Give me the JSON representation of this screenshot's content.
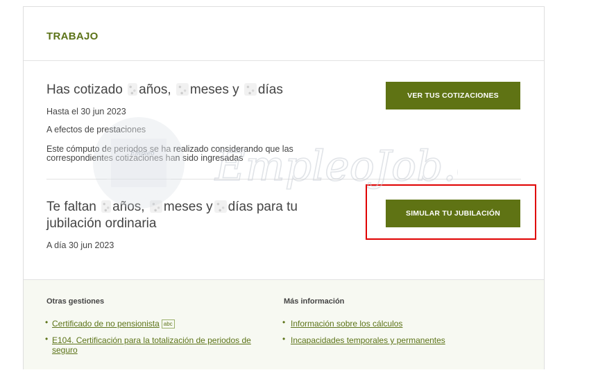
{
  "section": {
    "title": "TRABAJO"
  },
  "cotizado": {
    "heading_prefix": "Has cotizado",
    "heading_years": "años,",
    "heading_months": "meses y",
    "heading_days": "días",
    "date": "Hasta el 30 jun 2023",
    "purpose": "A efectos de prestaciones",
    "note_line1": "Este cómputo de periodos se ha realizado considerando que las",
    "note_line2": "correspondientes cotizaciones han sido ingresadas",
    "button": "VER TUS COTIZACIONES"
  },
  "faltan": {
    "heading_prefix": "Te faltan",
    "heading_years": "años,",
    "heading_months": "meses y",
    "heading_days": "días para tu",
    "heading_line2": "jubilación ordinaria",
    "date": "A día 30 jun 2023",
    "button": "SIMULAR TU JUBILACIÓN"
  },
  "footer": {
    "col1": {
      "title": "Otras gestiones",
      "links": [
        "Certificado de no pensionista",
        "E104. Certificación para la totalización de periodos de",
        "seguro"
      ],
      "badge": "abc"
    },
    "col2": {
      "title": "Más información",
      "links": [
        "Información sobre los cálculos",
        "Incapacidades temporales y permanentes"
      ]
    }
  },
  "watermark": {
    "text": "EmpleoJob.es",
    "logo": "Empleo"
  },
  "colors": {
    "accent": "#5f7314",
    "highlight": "#e00000",
    "footer_bg": "#f7f9f2"
  }
}
